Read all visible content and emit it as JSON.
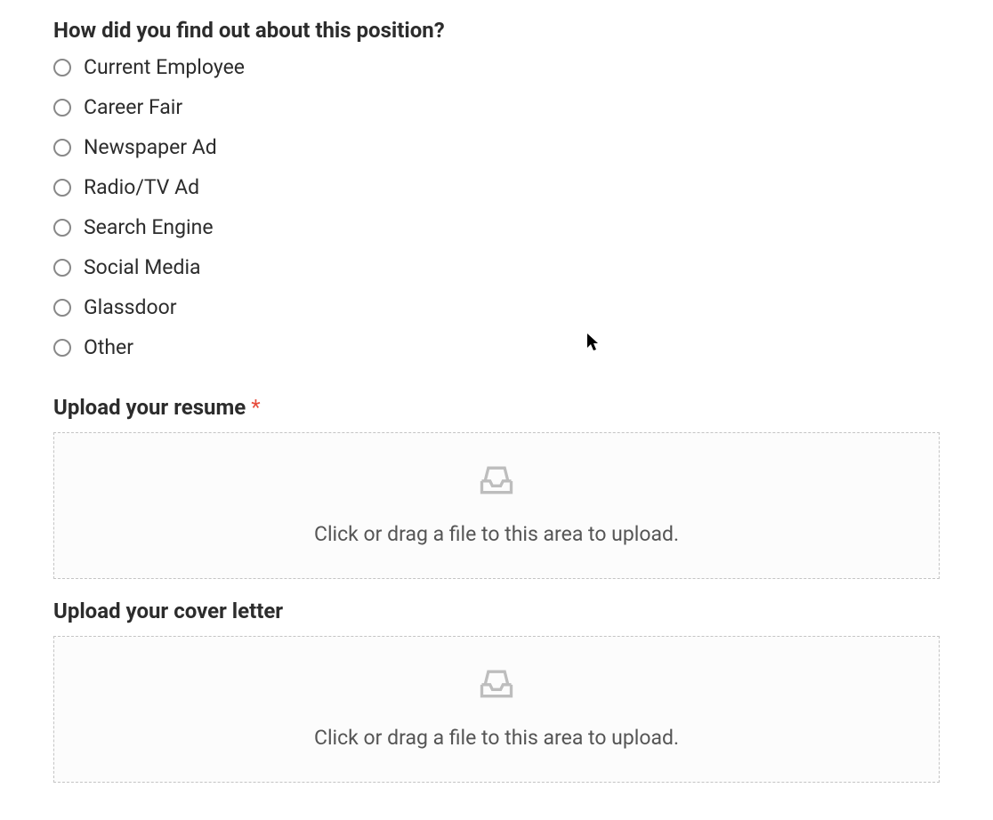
{
  "question": {
    "label": "How did you find out about this position?",
    "options": [
      "Current Employee",
      "Career Fair",
      "Newspaper Ad",
      "Radio/TV Ad",
      "Search Engine",
      "Social Media",
      "Glassdoor",
      "Other"
    ]
  },
  "resume": {
    "label": "Upload your resume ",
    "required_marker": "*",
    "prompt": "Click or drag a file to this area to upload."
  },
  "cover_letter": {
    "label": "Upload your cover letter",
    "prompt": "Click or drag a file to this area to upload."
  }
}
